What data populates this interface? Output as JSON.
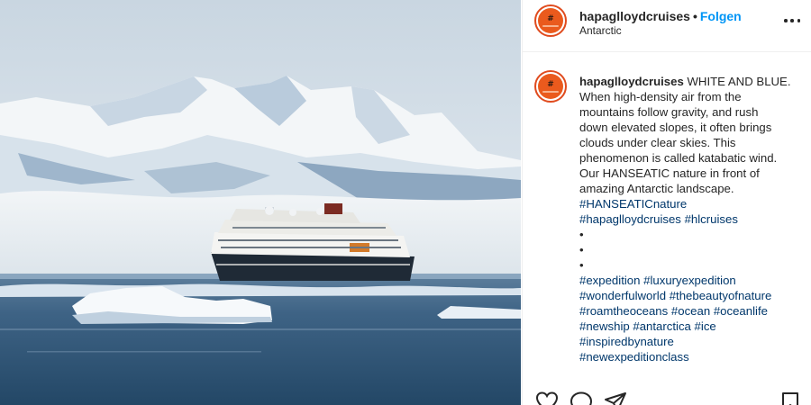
{
  "header": {
    "username": "hapaglloydcruises",
    "separator": "•",
    "follow_label": "Folgen",
    "location": "Antarctic"
  },
  "caption": {
    "username": "hapaglloydcruises",
    "lines": [
      "WHITE AND BLUE.",
      "When high-density air from the",
      "mountains follow gravity, and rush",
      "down elevated slopes, it often brings",
      "clouds under clear skies. This",
      "phenomenon is called katabatic wind.",
      "Our HANSEATIC nature in front of",
      "amazing Antarctic landscape."
    ],
    "tag_lines": [
      "#HANSEATICnature",
      "#hapaglloydcruises #hlcruises",
      "•",
      "•",
      "•",
      "#expedition #luxuryexpedition",
      "#wonderfulworld #thebeautyofnature",
      "#roamtheoceans #ocean #oceanlife",
      "#newship #antarctica #ice",
      "#inspiredbynature",
      "#newexpeditionclass"
    ]
  },
  "icons": {
    "avatar": "hapag-lloyd-logo-icon",
    "more": "more-options-icon",
    "like": "heart-icon",
    "comment": "comment-icon",
    "share": "share-icon",
    "save": "bookmark-icon"
  },
  "colors": {
    "follow": "#0095f6",
    "hashtag": "#00376b",
    "brand_orange": "#ea5a1d",
    "text": "#262626"
  }
}
